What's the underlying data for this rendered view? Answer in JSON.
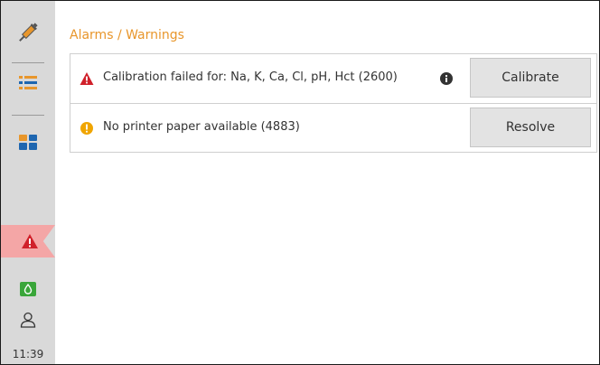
{
  "sidebar": {
    "icons": [
      "syringe-icon",
      "list-icon",
      "dashboard-icon",
      "alarm-warning-icon",
      "cartridge-icon",
      "user-icon"
    ],
    "time": "11:39"
  },
  "main": {
    "title": "Alarms / Warnings",
    "alarms": [
      {
        "severity": "error",
        "icon": "warning-triangle-icon",
        "text": "Calibration failed for: Na, K, Ca, Cl, pH, Hct (2600)",
        "has_info": true,
        "action_label": "Calibrate"
      },
      {
        "severity": "warning",
        "icon": "warning-circle-icon",
        "text": "No printer paper available (4883)",
        "has_info": false,
        "action_label": "Resolve"
      }
    ]
  },
  "colors": {
    "accent": "#e8962b",
    "error": "#d0202a",
    "warning": "#f0a500",
    "ok": "#3aa63a",
    "sidebar": "#d9d9d9",
    "alarm_tab": "#f4a6a6"
  }
}
